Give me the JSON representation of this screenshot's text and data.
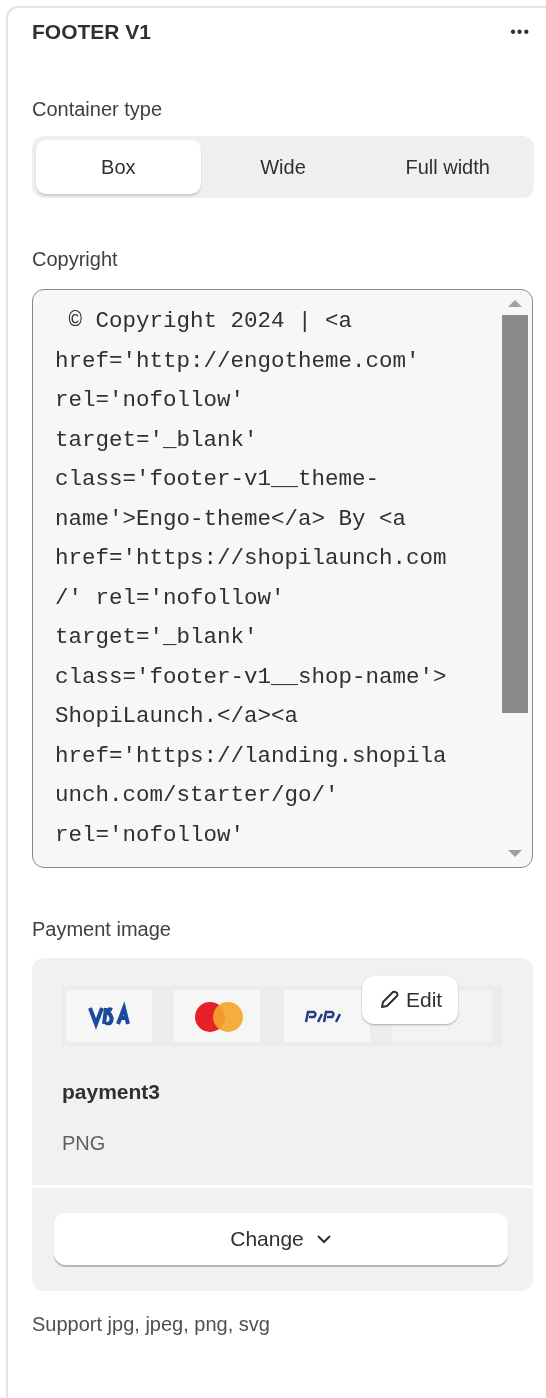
{
  "panel": {
    "title": "FOOTER V1",
    "menu": "•••"
  },
  "container_type": {
    "label": "Container type",
    "options": [
      {
        "label": "Box",
        "selected": true
      },
      {
        "label": "Wide",
        "selected": false
      },
      {
        "label": "Full width",
        "selected": false
      }
    ]
  },
  "copyright": {
    "label": "Copyright",
    "value_lines": [
      " © Copyright 2024 | <a",
      "href='http://engotheme.com'",
      "rel='nofollow'",
      "target='_blank'",
      "class='footer-v1__theme-",
      "name'>Engo-theme</a> By <a",
      "href='https://shopilaunch.com",
      "/' rel='nofollow'",
      "target='_blank'",
      "class='footer-v1__shop-name'>",
      "ShopiLaunch.</a><a",
      "href='https://landing.shopila",
      "unch.com/starter/go/'",
      "rel='nofollow'"
    ]
  },
  "payment_image": {
    "label": "Payment image",
    "edit_button": "Edit",
    "file_name": "payment3",
    "file_type": "PNG",
    "change_button": "Change",
    "help": "Support jpg, jpeg, png, svg"
  }
}
